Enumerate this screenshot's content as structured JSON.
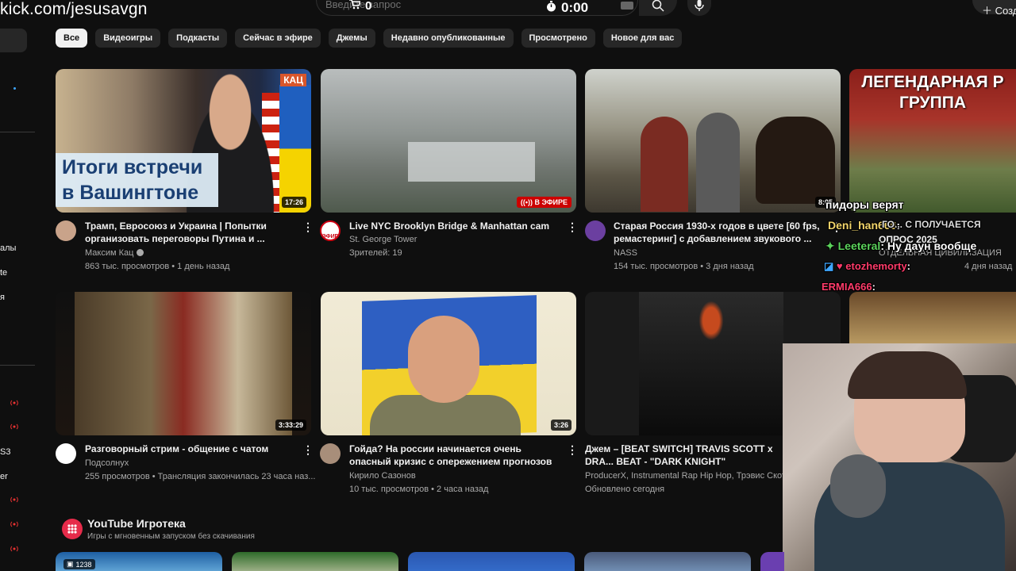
{
  "overlay": {
    "url": "kick.com/jesusavgn"
  },
  "header": {
    "search_placeholder": "Введите запрос",
    "cart_count": "0",
    "timer": "0:00",
    "create_label": "Созд"
  },
  "sidebar": {
    "texts": [
      "алы",
      "te",
      "я",
      "S3",
      "er"
    ]
  },
  "chips": [
    "Все",
    "Видеоигры",
    "Подкасты",
    "Сейчас в эфире",
    "Джемы",
    "Недавно опубликованные",
    "Просмотрено",
    "Новое для вас"
  ],
  "videos": [
    {
      "title": "Трамп, Евросоюз и Украина | Попытки организовать переговоры Путина и ...",
      "channel": "Максим Кац",
      "meta": "863 тыс. просмотров • 1 день назад",
      "duration": "17:26",
      "thumb_caption": "Итоги встречи в Вашингтоне",
      "thumb_tag": "КАЦ"
    },
    {
      "title": "Live NYC Brooklyn Bridge & Manhattan cam",
      "channel": "St. George Tower",
      "meta": "Зрителей: 19",
      "live_badge": "В ЭФИРЕ",
      "avatar_label": "ЭФИР"
    },
    {
      "title": "Старая Россия 1930-х годов в цвете [60 fps, ремастеринг] с добавлением звукового ...",
      "channel": "NASS",
      "meta": "154 тыс. просмотров • 3 дня назад",
      "duration": "8:05"
    },
    {
      "thumb_caption": "ЛЕГЕНДАРНАЯ Р ГРУППА",
      "title_fragment": "ОПРОС 2025",
      "channel_fragment": "ОТДЕЛЬНАЯ ЦИВИЛИЗАЦИЯ",
      "meta_fragment": "4 дня назад",
      "title_overlap": "ГО... С ПОЛУЧАЕТСЯ"
    },
    {
      "title": "Разговорный стрим - общение с чатом",
      "channel": "Подсолнух",
      "meta": "255 просмотров • Трансляция закончилась 23 часа наз...",
      "duration": "3:33:29"
    },
    {
      "title": "Гойда? На россии начинается очень опасный кризис с опережением прогнозов",
      "channel": "Кирило Сазонов",
      "meta": "10 тыс. просмотров • 2 часа назад",
      "duration": "3:26"
    },
    {
      "title": "Джем – [BEAT SWITCH] TRAVIS SCOTT x DRA... BEAT - \"DARK KNIGHT\"",
      "channel": "ProducerX, Instrumental Rap Hip Hop, Трэвис Скотт",
      "meta": "Обновлено сегодня"
    }
  ],
  "chat": [
    {
      "user": "",
      "text": "пидоры верят",
      "color": "#ffffff"
    },
    {
      "user": "Deni_han666",
      "text": ":",
      "color": "#f2d56b"
    },
    {
      "user": "Leeteral",
      "text": ": Ну даун вообще",
      "color": "#5bd35b"
    },
    {
      "user": "etozhemorty",
      "text": ":",
      "color": "#ff3b6a"
    },
    {
      "user": "ERMIA666",
      "text": ":",
      "color": "#ff3b6a"
    }
  ],
  "playables": {
    "title": "YouTube Игротека",
    "subtitle": "Игры с мгновенным запуском без скачивания",
    "badge_count": "1238"
  }
}
